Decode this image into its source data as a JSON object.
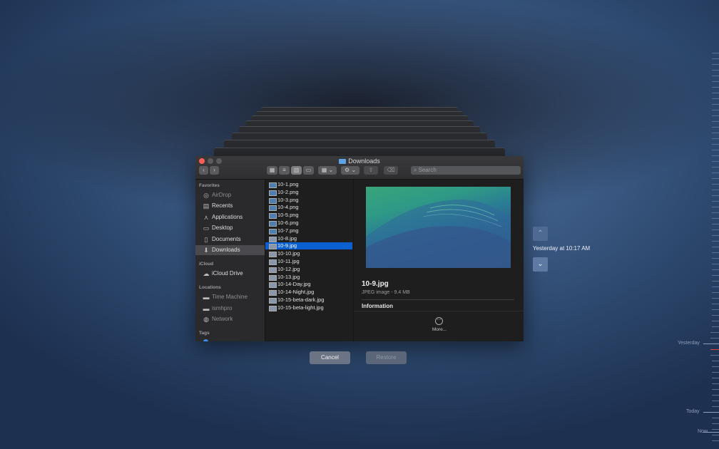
{
  "window": {
    "title": "Downloads",
    "search_placeholder": "Search"
  },
  "sidebar": {
    "sections": [
      {
        "label": "Favorites"
      },
      {
        "label": "iCloud"
      },
      {
        "label": "Locations"
      },
      {
        "label": "Tags"
      }
    ],
    "items": [
      {
        "label": "AirDrop",
        "icon": "airdrop-icon",
        "enabled": false
      },
      {
        "label": "Recents",
        "icon": "clock-icon",
        "enabled": true
      },
      {
        "label": "Applications",
        "icon": "applications-icon",
        "enabled": true
      },
      {
        "label": "Desktop",
        "icon": "desktop-icon",
        "enabled": true
      },
      {
        "label": "Documents",
        "icon": "document-icon",
        "enabled": true
      },
      {
        "label": "Downloads",
        "icon": "download-icon",
        "enabled": true,
        "selected": true
      },
      {
        "label": "iCloud Drive",
        "icon": "cloud-icon",
        "enabled": true
      },
      {
        "label": "Time Machine",
        "icon": "disk-icon",
        "enabled": false
      },
      {
        "label": "ismhpro",
        "icon": "disk-icon",
        "enabled": false
      },
      {
        "label": "Network",
        "icon": "globe-icon",
        "enabled": false
      }
    ]
  },
  "files": [
    "10-1.png",
    "10-2.png",
    "10-3.png",
    "10-4.png",
    "10-5.png",
    "10-6.png",
    "10-7.png",
    "10-8.jpg",
    "10-9.jpg",
    "10-10.jpg",
    "10-11.jpg",
    "10-12.jpg",
    "10-13.jpg",
    "10-14-Day.jpg",
    "10-14-Night.jpg",
    "10-15-beta-dark.jpg",
    "10-15-beta-light.jpg"
  ],
  "selected_file_index": 8,
  "preview": {
    "name": "10-9.jpg",
    "meta": "JPEG image - 9.4 MB",
    "section_label": "Information",
    "more_label": "More..."
  },
  "buttons": {
    "cancel": "Cancel",
    "restore": "Restore"
  },
  "timemachine": {
    "snapshot_label": "Yesterday at 10:17 AM",
    "timeline_labels": {
      "yesterday": "Yesterday",
      "today": "Today",
      "now": "Now"
    }
  },
  "colors": {
    "selection": "#0b5fce",
    "close": "#ff5f57",
    "accent_red": "#e0473c"
  }
}
